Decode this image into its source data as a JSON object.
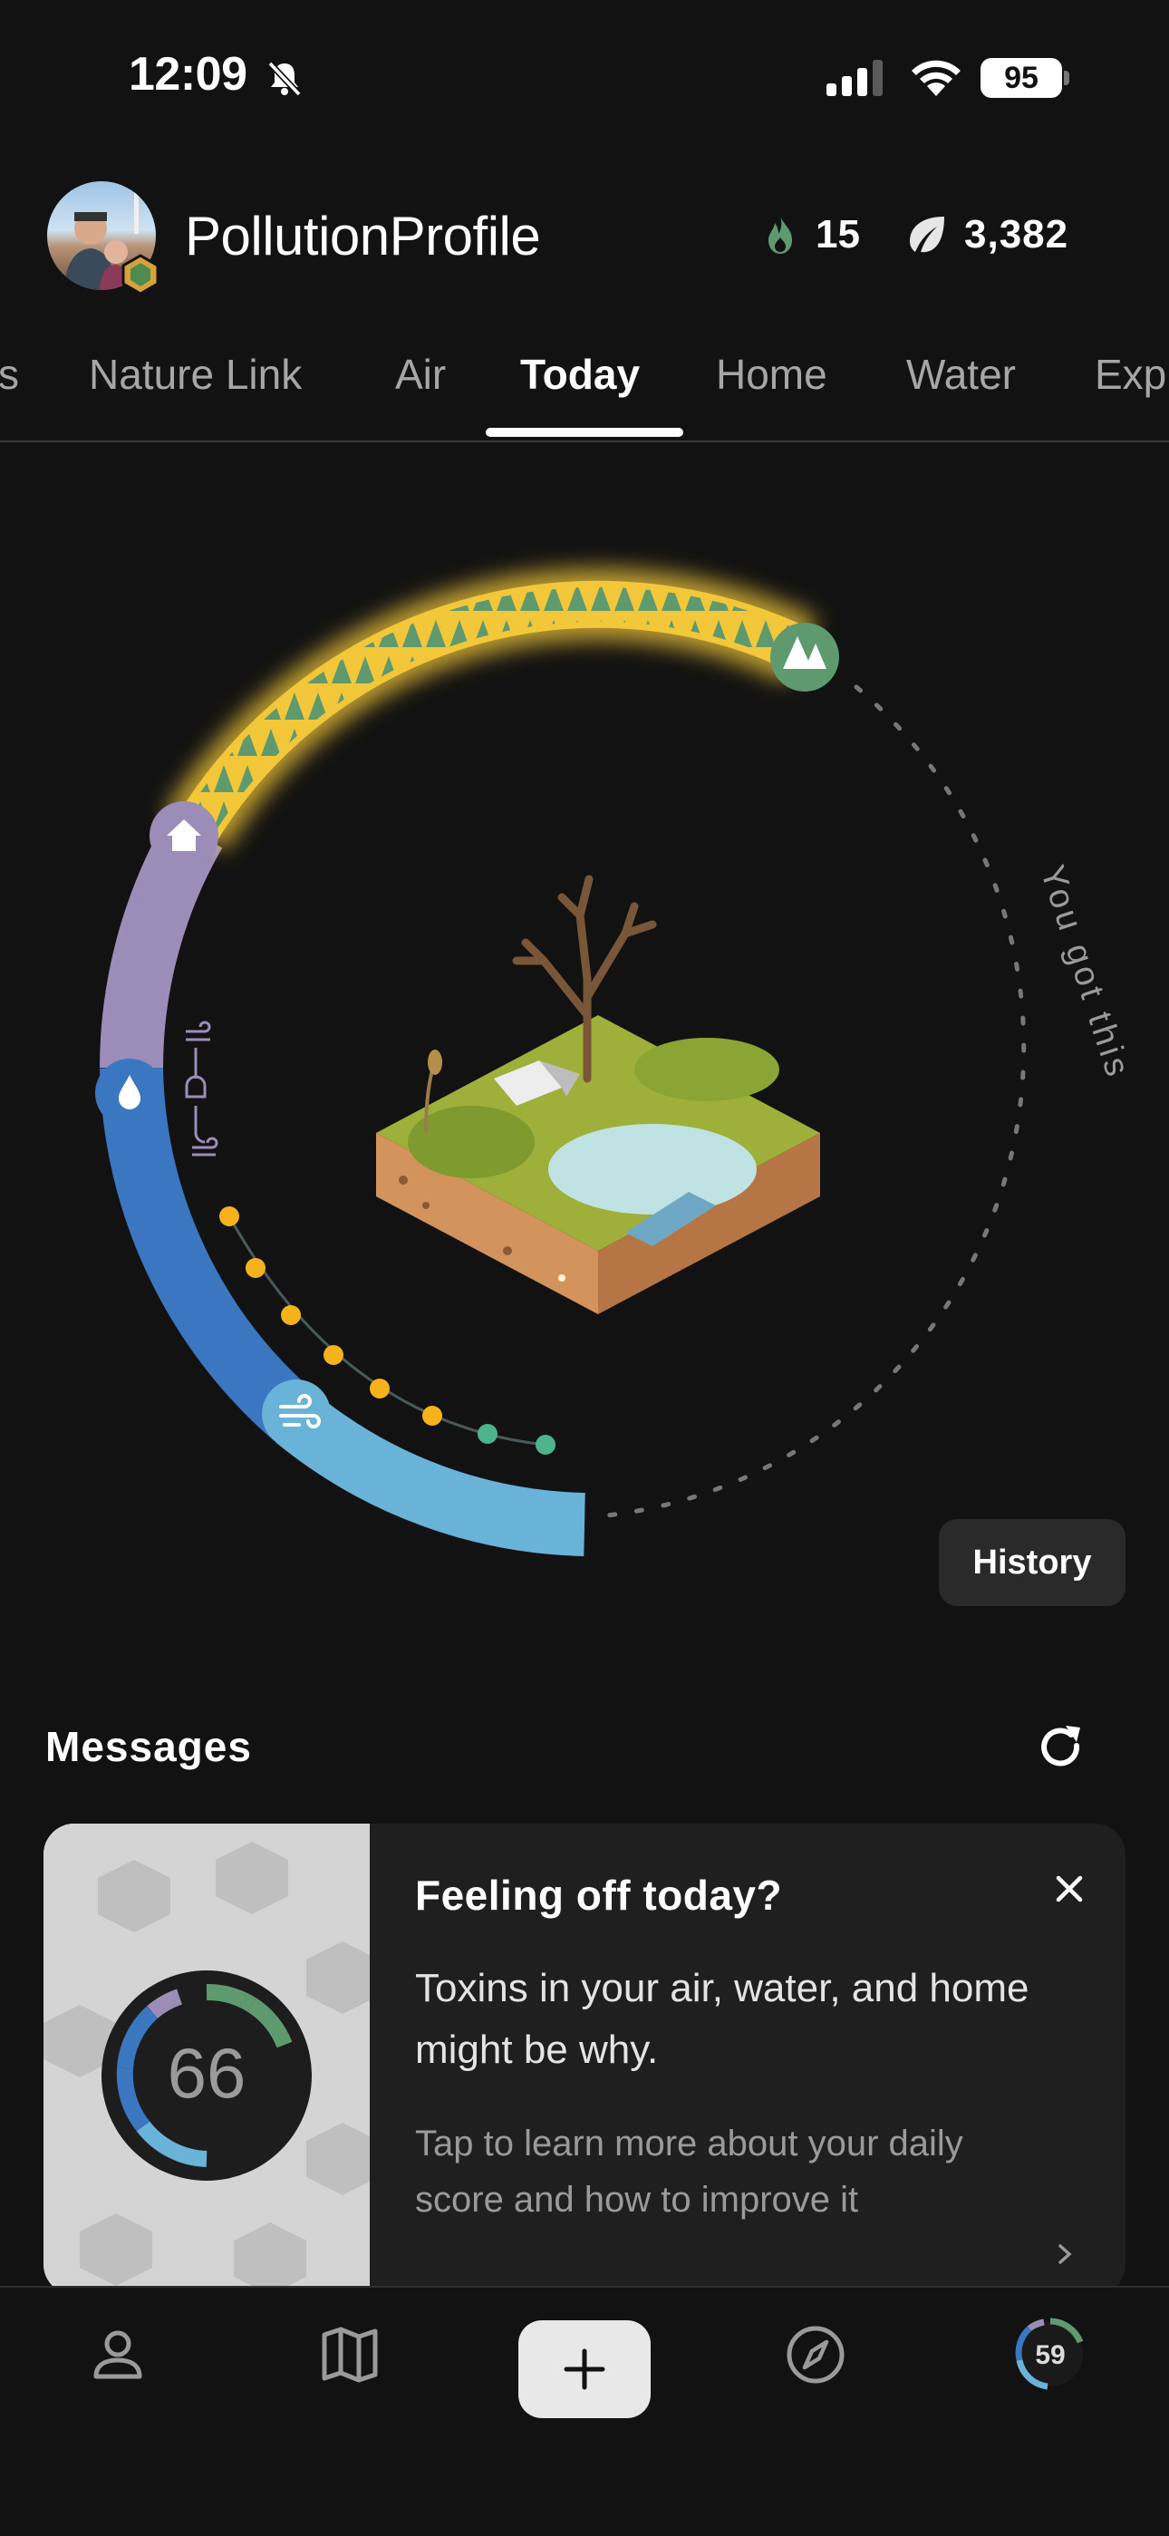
{
  "status_bar": {
    "time": "12:09",
    "battery": "95"
  },
  "header": {
    "profile_name": "PollutionProfile",
    "streak": "15",
    "points": "3,382"
  },
  "tabs": [
    {
      "label": "s"
    },
    {
      "label": "Nature Link"
    },
    {
      "label": "Air"
    },
    {
      "label": "Today",
      "active": true
    },
    {
      "label": "Home"
    },
    {
      "label": "Water"
    },
    {
      "label": "Exp"
    }
  ],
  "ring": {
    "motivation": "You got this",
    "history_label": "History"
  },
  "messages": {
    "title": "Messages",
    "card": {
      "score": "66",
      "title": "Feeling off today?",
      "body": "Toxins in your air, water, and home might be why.",
      "sub": "Tap to learn more about your daily score and how to improve it"
    }
  },
  "nav": {
    "score": "59"
  },
  "colors": {
    "nature": "#5f9a6f",
    "home": "#9b8cb8",
    "water": "#3b76c0",
    "air": "#69b3d9",
    "glow": "#f3c73a",
    "dot_yellow": "#f5b21b",
    "dot_green": "#4db38c"
  }
}
